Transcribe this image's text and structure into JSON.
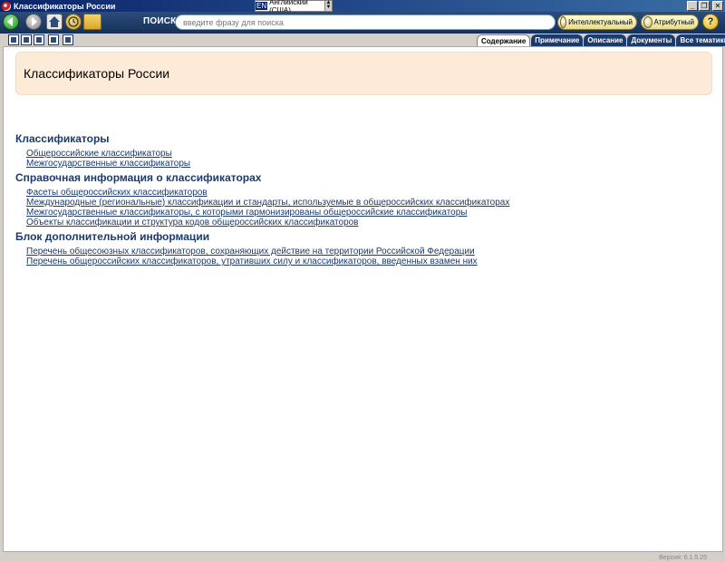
{
  "window": {
    "title": "Классификаторы России",
    "language_code": "EN",
    "language_name": "Английский (США)",
    "buttons": {
      "minimize": "_",
      "restore": "❐",
      "close": "✕"
    }
  },
  "toolbar": {
    "search_label": "ПОИСК",
    "search_placeholder": "введите фразу для поиска",
    "intel_button": "Интеллектуальный",
    "attr_button": "Атрибутный",
    "help": "?"
  },
  "tabs": [
    {
      "label": "Содержание",
      "active": true
    },
    {
      "label": "Примечание",
      "active": false
    },
    {
      "label": "Описание",
      "active": false
    },
    {
      "label": "Документы",
      "active": false
    },
    {
      "label": "Все тематики",
      "active": false
    }
  ],
  "page": {
    "heading": "Классификаторы России",
    "sections": [
      {
        "title": "Классификаторы",
        "links": [
          "Общероссийские классификаторы",
          "Межгосударственные классификаторы  "
        ]
      },
      {
        "title": "Справочная информация о классификаторах",
        "links": [
          "Фасеты общероссийских классификаторов",
          "Международные (региональные) классификации и стандарты, используемые в общероссийских классификаторах",
          "Межгосударственные классификаторы, с которыми гармонизированы общероссийские классификаторы",
          "Объекты классификации и структура кодов общероссийских классификаторов "
        ]
      },
      {
        "title": "Блок дополнительной информации",
        "links": [
          "Перечень общесоюзных классификаторов, сохраняющих действие на территории Российской Федерации",
          "Перечень общероссийских классификаторов, утративших силу и классификаторов, введенных взамен них"
        ]
      }
    ]
  },
  "status": {
    "version": "Версия: 6.1.5.25"
  }
}
